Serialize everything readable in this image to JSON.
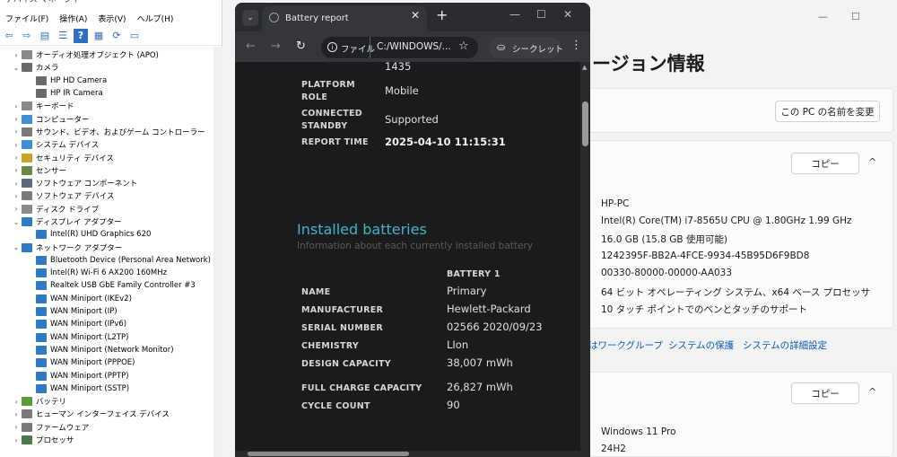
{
  "device_manager": {
    "title": "デバイス マネージャー",
    "menu": [
      "ファイル(F)",
      "操作(A)",
      "表示(V)",
      "ヘルプ(H)"
    ],
    "tree": [
      {
        "label": "オーディオ処理オブジェクト (APO)",
        "level": 0,
        "expanded": false,
        "icon": "audio-icon",
        "color": "#8a8a8a"
      },
      {
        "label": "カメラ",
        "level": 0,
        "expanded": true,
        "icon": "camera-icon",
        "color": "#6a6a6a"
      },
      {
        "label": "HP HD Camera",
        "level": 1,
        "icon": "camera-icon",
        "color": "#6a6a6a"
      },
      {
        "label": "HP IR Camera",
        "level": 1,
        "icon": "camera-icon",
        "color": "#6a6a6a"
      },
      {
        "label": "キーボード",
        "level": 0,
        "expanded": false,
        "icon": "keyboard-icon",
        "color": "#888888"
      },
      {
        "label": "コンピューター",
        "level": 0,
        "expanded": false,
        "icon": "computer-icon",
        "color": "#3d8fd6"
      },
      {
        "label": "サウンド、ビデオ、およびゲーム コントローラー",
        "level": 0,
        "expanded": false,
        "icon": "speaker-icon",
        "color": "#7a7a7a"
      },
      {
        "label": "システム デバイス",
        "level": 0,
        "expanded": false,
        "icon": "system-device-icon",
        "color": "#3d8fd6"
      },
      {
        "label": "セキュリティ デバイス",
        "level": 0,
        "expanded": false,
        "icon": "security-icon",
        "color": "#c9a227"
      },
      {
        "label": "センサー",
        "level": 0,
        "expanded": false,
        "icon": "sensor-icon",
        "color": "#6a8a4a"
      },
      {
        "label": "ソフトウェア コンポーネント",
        "level": 0,
        "expanded": false,
        "icon": "software-component-icon",
        "color": "#5a6a7a"
      },
      {
        "label": "ソフトウェア デバイス",
        "level": 0,
        "expanded": false,
        "icon": "software-device-icon",
        "color": "#7a7a7a"
      },
      {
        "label": "ディスク ドライブ",
        "level": 0,
        "expanded": false,
        "icon": "disk-icon",
        "color": "#8a8a8a"
      },
      {
        "label": "ディスプレイ アダプター",
        "level": 0,
        "expanded": true,
        "icon": "display-icon",
        "color": "#2e7bc4"
      },
      {
        "label": "Intel(R) UHD Graphics 620",
        "level": 1,
        "icon": "display-icon",
        "color": "#2e7bc4"
      },
      {
        "label": "ネットワーク アダプター",
        "level": 0,
        "expanded": true,
        "icon": "network-icon",
        "color": "#2e7bc4"
      },
      {
        "label": "Bluetooth Device (Personal Area Network)",
        "level": 1,
        "icon": "network-icon",
        "color": "#2e7bc4"
      },
      {
        "label": "Intel(R) Wi-Fi 6 AX200 160MHz",
        "level": 1,
        "icon": "network-icon",
        "color": "#2e7bc4"
      },
      {
        "label": "Realtek USB GbE Family Controller #3",
        "level": 1,
        "icon": "network-icon",
        "color": "#2e7bc4"
      },
      {
        "label": "WAN Miniport (IKEv2)",
        "level": 1,
        "icon": "network-icon",
        "color": "#2e7bc4"
      },
      {
        "label": "WAN Miniport (IP)",
        "level": 1,
        "icon": "network-icon",
        "color": "#2e7bc4"
      },
      {
        "label": "WAN Miniport (IPv6)",
        "level": 1,
        "icon": "network-icon",
        "color": "#2e7bc4"
      },
      {
        "label": "WAN Miniport (L2TP)",
        "level": 1,
        "icon": "network-icon",
        "color": "#2e7bc4"
      },
      {
        "label": "WAN Miniport (Network Monitor)",
        "level": 1,
        "icon": "network-icon",
        "color": "#2e7bc4"
      },
      {
        "label": "WAN Miniport (PPPOE)",
        "level": 1,
        "icon": "network-icon",
        "color": "#2e7bc4"
      },
      {
        "label": "WAN Miniport (PPTP)",
        "level": 1,
        "icon": "network-icon",
        "color": "#2e7bc4"
      },
      {
        "label": "WAN Miniport (SSTP)",
        "level": 1,
        "icon": "network-icon",
        "color": "#2e7bc4"
      },
      {
        "label": "バッテリ",
        "level": 0,
        "expanded": false,
        "icon": "battery-icon",
        "color": "#5a9a3a"
      },
      {
        "label": "ヒューマン インターフェイス デバイス",
        "level": 0,
        "expanded": false,
        "icon": "hid-icon",
        "color": "#7a7a7a"
      },
      {
        "label": "ファームウェア",
        "level": 0,
        "expanded": false,
        "icon": "firmware-icon",
        "color": "#7a7a7a"
      },
      {
        "label": "プロセッサ",
        "level": 0,
        "expanded": false,
        "icon": "processor-icon",
        "color": "#4a7a4a"
      }
    ]
  },
  "chrome": {
    "tab_title": "Battery report",
    "address_label": "ファイル",
    "address_text": "C:/WINDOWS/...",
    "incognito_label": "シークレット",
    "new_tab": "+",
    "report": {
      "top_value": "1435",
      "rows_top": [
        {
          "label_line1": "PLATFORM",
          "label_line2": "ROLE",
          "value": "Mobile"
        },
        {
          "label_line1": "CONNECTED",
          "label_line2": "STANDBY",
          "value": "Supported"
        },
        {
          "label_line1": "REPORT TIME",
          "label_line2": "",
          "value": "2025-04-10  11:15:31"
        }
      ],
      "section_title": "Installed batteries",
      "section_subtitle": "Information about each currently installed battery",
      "column_header": "BATTERY 1",
      "rows": [
        {
          "label": "NAME",
          "value": "Primary"
        },
        {
          "label": "MANUFACTURER",
          "value": "Hewlett-Packard"
        },
        {
          "label": "SERIAL NUMBER",
          "value": "02566 2020/09/23"
        },
        {
          "label": "CHEMISTRY",
          "value": "LIon"
        },
        {
          "label": "DESIGN CAPACITY",
          "value": "38,007 mWh"
        },
        {
          "label": "FULL CHARGE CAPACITY",
          "value": "26,827 mWh"
        },
        {
          "label": "CYCLE COUNT",
          "value": "90"
        }
      ]
    },
    "colors": {
      "section_title": "#3fb6c6",
      "subtitle": "#5a5a5a"
    }
  },
  "settings": {
    "title_partial": "ージョン情報",
    "rename_button": "この PC の名前を変更",
    "copy_button_1": "コピー",
    "copy_button_2": "コピー",
    "specs": [
      "HP-PC",
      "Intel(R) Core(TM) i7-8565U CPU @ 1.80GHz   1.99 GHz",
      "16.0 GB (15.8 GB 使用可能)",
      "1242395F-BB2A-4FCE-9934-45B95D6F9BD8",
      "00330-80000-00000-AA033",
      "64 ビット オペレーティング システム、x64 ベース プロセッサ",
      "10 タッチ ポイントでのペンとタッチのサポート"
    ],
    "links": [
      "はワークグループ",
      "システムの保護",
      "システムの詳細設定"
    ],
    "win_specs": [
      "Windows 11 Pro",
      "24H2"
    ]
  }
}
